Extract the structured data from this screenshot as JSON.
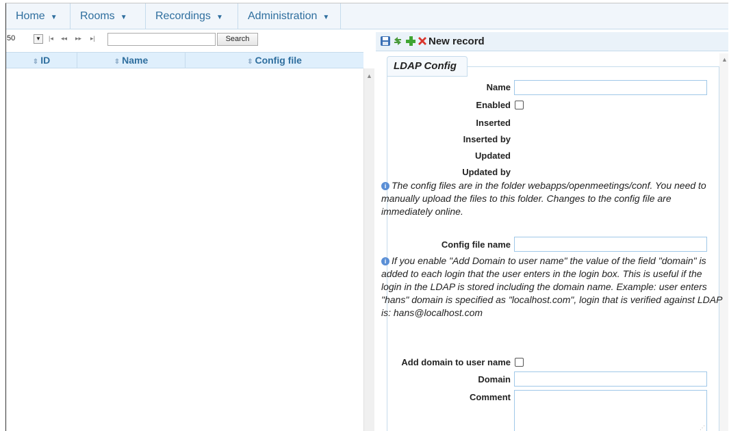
{
  "menu": {
    "items": [
      {
        "label": "Home"
      },
      {
        "label": "Rooms"
      },
      {
        "label": "Recordings"
      },
      {
        "label": "Administration"
      }
    ]
  },
  "grid": {
    "page_size": "50",
    "search_value": "",
    "search_button": "Search",
    "columns": [
      "ID",
      "Name",
      "Config file"
    ],
    "rows": []
  },
  "form": {
    "toolbar": {
      "new_record_label": "New record"
    },
    "legend": "LDAP Config",
    "fields": {
      "name_label": "Name",
      "enabled_label": "Enabled",
      "inserted_label": "Inserted",
      "inserted_by_label": "Inserted by",
      "updated_label": "Updated",
      "updated_by_label": "Updated by",
      "config_file_name_label": "Config file name",
      "add_domain_label": "Add domain to user name",
      "domain_label": "Domain",
      "comment_label": "Comment"
    },
    "info_config": "The config files are in the folder webapps/openmeetings/conf. You need to manually upload the files to this folder. Changes to the config file are immediately online.",
    "info_domain": "If you enable \"Add Domain to user name\" the value of the field \"domain\" is added to each login that the user enters in the login box. This is useful if the login in the LDAP is stored including the domain name. Example: user enters \"hans\" domain is specified as \"localhost.com\", login that is verified against LDAP is: hans@localhost.com",
    "enabled_checked": false,
    "add_domain_checked": false
  },
  "colors": {
    "menu_text": "#2e6e9e",
    "header_bg": "#dfeffc",
    "border": "#c5dbec"
  }
}
